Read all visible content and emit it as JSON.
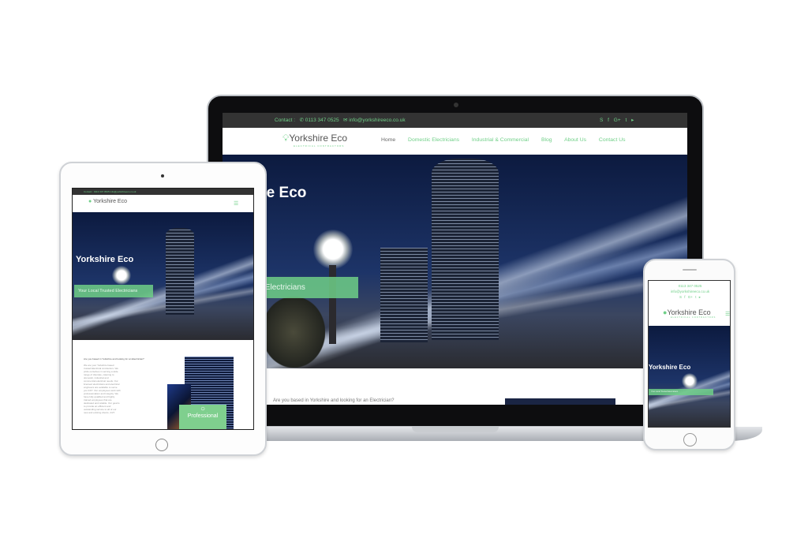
{
  "site": {
    "contact_label": "Contact :",
    "phone": "0113 347 0525",
    "email": "info@yorkshireeco.co.uk",
    "social_icons": [
      "skype-icon",
      "facebook-icon",
      "google-plus-icon",
      "twitter-icon",
      "youtube-icon"
    ],
    "social_glyphs": [
      "S",
      "f",
      "G+",
      "t",
      "▸"
    ],
    "logo_name": "Yorkshire Eco",
    "logo_sub": "ELECTRICAL CONTRACTORS",
    "nav": [
      "Home",
      "Domestic Electricians",
      "Industrial & Commercial",
      "Blog",
      "About Us",
      "Contact Us"
    ],
    "hero_title": "Yorkshire Eco",
    "hero_tagline": "Your Local Trusted Electricians",
    "intro_heading": "Are you based in Yorkshire and looking for an Electrician?",
    "intro_body": "We are your Yorkshire based trusted Electrical contractors. We pride ourselves in serving a wide range of clientele, catering to domestic, industrial and commercial electrical needs. Our licensed electricians and electrical engineers are available to serve you 24/7. Our employees work with professionalism and integrity. We have fully qualified and highly trained employees that are dedicated and reliable. Our goal is to provide an efficient and outstanding service to all of our new and existing clients, 24/7.",
    "feature_label": "Professional",
    "menu_icon": "☰"
  },
  "colors": {
    "accent": "#6fcf87",
    "topbar": "#333333"
  }
}
